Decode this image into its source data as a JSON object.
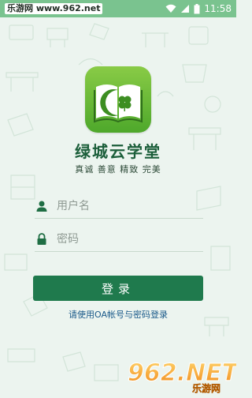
{
  "status_bar": {
    "source_label": "乐游网 www.962.net",
    "time": "11:58"
  },
  "app": {
    "title": "绿城云学堂",
    "slogan": "真诚 善意 精致 完美"
  },
  "form": {
    "username_placeholder": "用户名",
    "password_placeholder": "密码",
    "login_label": "登录",
    "hint": "请使用OA帐号与密码登录"
  },
  "watermark": {
    "text": "962.NET",
    "subtext": "乐游网"
  },
  "colors": {
    "status_bar": "#7ac38f",
    "background": "#ecf4ef",
    "title": "#1b5e3a",
    "button": "#1f7a4d",
    "hint": "#1a5a8a",
    "icon_green_light": "#89cb46",
    "icon_green_dark": "#4ea82b"
  },
  "icons": {
    "wifi": "wifi-icon",
    "signal": "signal-icon",
    "battery": "battery-icon",
    "username": "person-icon",
    "password": "lock-icon",
    "app": "book-clover-icon"
  }
}
